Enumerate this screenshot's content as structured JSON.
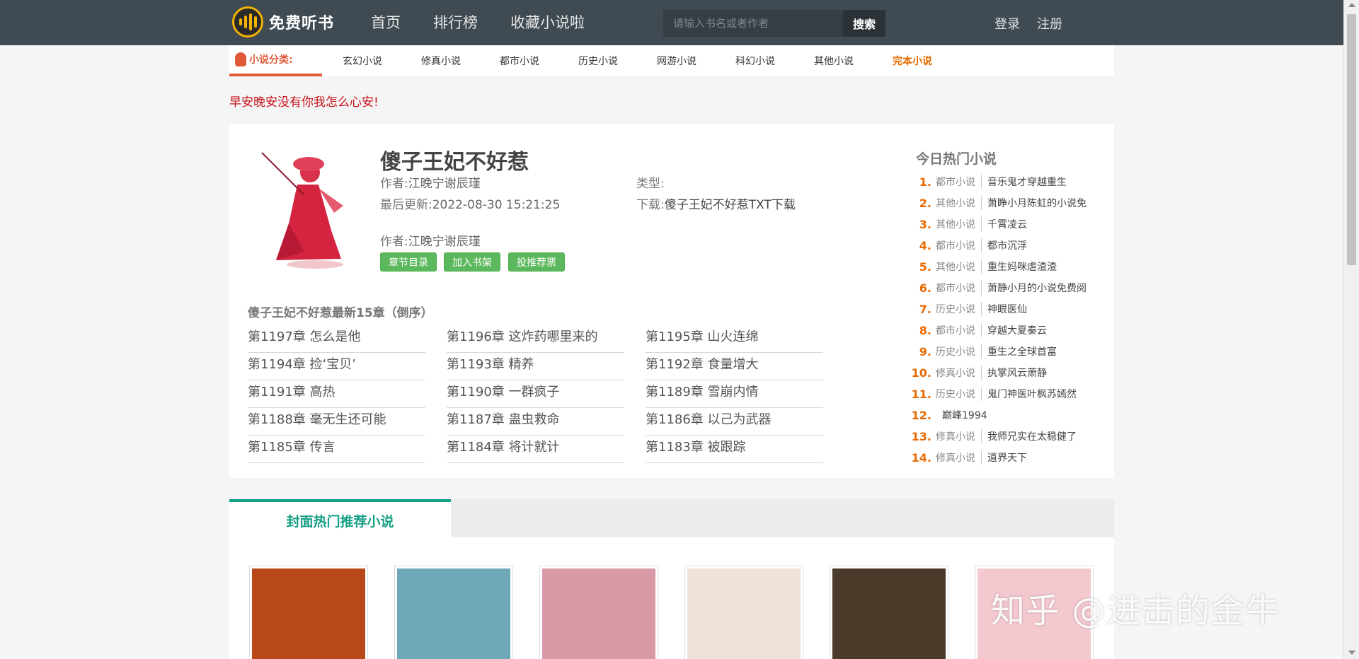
{
  "header": {
    "logo_text": "免费听书",
    "nav": [
      "首页",
      "排行榜",
      "收藏小说啦"
    ],
    "search_placeholder": "请输入书名或者作者",
    "search_button": "搜索",
    "login": "登录",
    "register": "注册"
  },
  "categories": {
    "label": "小说分类:",
    "items": [
      "玄幻小说",
      "修真小说",
      "都市小说",
      "历史小说",
      "网游小说",
      "科幻小说",
      "其他小说",
      "完本小说"
    ]
  },
  "slogan": "早安晚安没有你我怎么心安!",
  "book": {
    "title": "傻子王妃不好惹",
    "author_label": "作者:",
    "author": "江晚宁谢辰瑾",
    "type_label": "类型:",
    "type": "",
    "updated_label": "最后更新:",
    "updated": "2022-08-30 15:21:25",
    "download_label": "下载:",
    "download": "傻子王妃不好惹TXT下载",
    "author2_label": "作者:",
    "author2": "江晚宁谢辰瑾",
    "buttons": [
      "章节目录",
      "加入书架",
      "投推荐票"
    ]
  },
  "latest": {
    "heading": "傻子王妃不好惹最新15章（倒序）",
    "chapters": [
      "第1197章 怎么是他",
      "第1196章 这炸药哪里来的",
      "第1195章 山火连绵",
      "第1194章 捡‘宝贝’",
      "第1193章 精养",
      "第1192章 食量增大",
      "第1191章 高热",
      "第1190章 一群疯子",
      "第1189章 雪崩内情",
      "第1188章 毫无生还可能",
      "第1187章 蛊虫救命",
      "第1186章 以己为武器",
      "第1185章 传言",
      "第1184章 将计就计",
      "第1183章 被跟踪"
    ]
  },
  "hot": {
    "heading": "今日热门小说",
    "items": [
      {
        "num": "1.",
        "cat": "都市小说",
        "name": "音乐鬼才穿越重生"
      },
      {
        "num": "2.",
        "cat": "其他小说",
        "name": "萧睁小月陈虹的小说免"
      },
      {
        "num": "3.",
        "cat": "其他小说",
        "name": "千霄凌云"
      },
      {
        "num": "4.",
        "cat": "都市小说",
        "name": "都市沉浮"
      },
      {
        "num": "5.",
        "cat": "其他小说",
        "name": "重生妈咪虐渣渣"
      },
      {
        "num": "6.",
        "cat": "都市小说",
        "name": "萧静小月的小说免费阅"
      },
      {
        "num": "7.",
        "cat": "历史小说",
        "name": "神眼医仙"
      },
      {
        "num": "8.",
        "cat": "都市小说",
        "name": "穿越大夏秦云"
      },
      {
        "num": "9.",
        "cat": "历史小说",
        "name": "重生之全球首富"
      },
      {
        "num": "10.",
        "cat": "修真小说",
        "name": "执掌风云萧静"
      },
      {
        "num": "11.",
        "cat": "历史小说",
        "name": "鬼门神医叶枫苏嫣然"
      },
      {
        "num": "12.",
        "cat": "",
        "name": "巅峰1994"
      },
      {
        "num": "13.",
        "cat": "修真小说",
        "name": "我师兄实在太稳健了"
      },
      {
        "num": "14.",
        "cat": "修真小说",
        "name": "道界天下"
      }
    ]
  },
  "recommend": {
    "tab": "封面热门推荐小说",
    "cover_colors": [
      "#b8481a",
      "#6fa9b8",
      "#d99aa8",
      "#efe2d8",
      "#4a3a2a",
      "#f3c9cf"
    ]
  },
  "watermark": "知乎 @进击的金牛"
}
